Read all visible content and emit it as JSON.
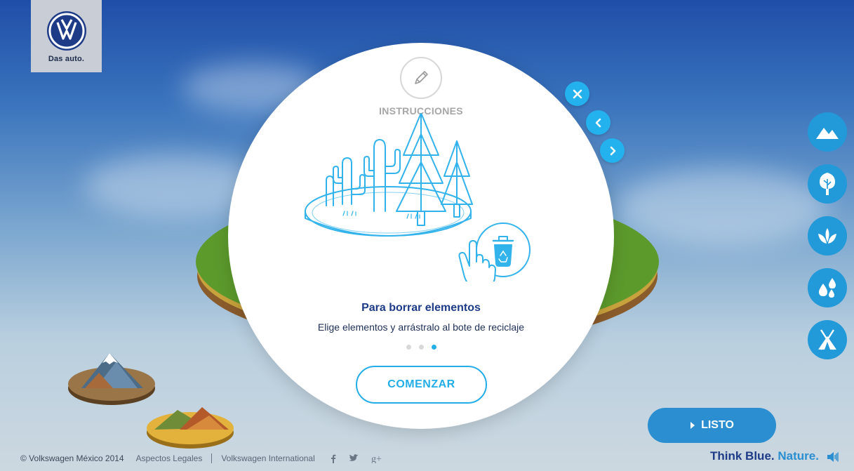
{
  "brand": {
    "caption": "Das auto."
  },
  "modal": {
    "title": "INSTRUCCIONES",
    "step_title": "Para borrar elementos",
    "step_description": "Elige elementos y arrástralo al bote de reciclaje",
    "pagination": {
      "current": 3,
      "total": 3
    },
    "start_label": "COMENZAR"
  },
  "controls": {
    "close_icon": "close-icon",
    "prev_icon": "chevron-left-icon",
    "next_icon": "chevron-right-icon"
  },
  "categories": [
    {
      "name": "mountains",
      "icon": "mountain-icon"
    },
    {
      "name": "trees",
      "icon": "tree-icon"
    },
    {
      "name": "plants",
      "icon": "plant-icon"
    },
    {
      "name": "water",
      "icon": "water-drops-icon"
    },
    {
      "name": "camping",
      "icon": "tent-icon"
    }
  ],
  "listo_label": "LISTO",
  "footer": {
    "copyright": "© Volkswagen México 2014",
    "legal": "Aspectos Legales",
    "international": "Volkswagen International",
    "social": [
      "facebook-icon",
      "twitter-icon",
      "google-plus-icon"
    ]
  },
  "tagline": {
    "primary": "Think Blue.",
    "secondary": "Nature."
  },
  "colors": {
    "accent": "#23aee8",
    "brand_dark": "#1d3b87",
    "button_blue": "#2a8ed0"
  }
}
